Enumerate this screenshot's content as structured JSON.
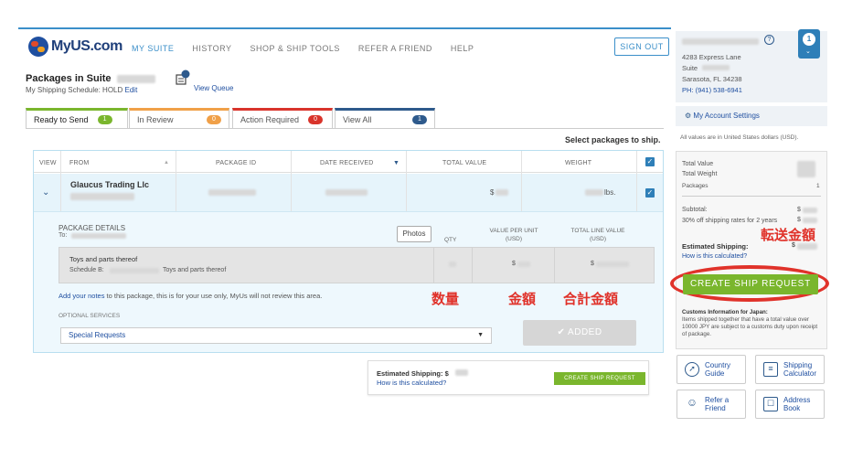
{
  "brand": {
    "name": "MyUS.com"
  },
  "nav": {
    "items": [
      "MY SUITE",
      "HISTORY",
      "SHOP & SHIP TOOLS",
      "REFER A FRIEND",
      "HELP"
    ],
    "sign_out": "SIGN OUT"
  },
  "suite": {
    "title": "Packages in Suite",
    "schedule_label": "My Shipping Schedule: HOLD",
    "edit": "Edit",
    "queue_count": "0",
    "view_queue": "View Queue"
  },
  "tabs": [
    {
      "label": "Ready to Send",
      "count": "1",
      "color": "#7ab62d"
    },
    {
      "label": "In Review",
      "count": "0",
      "color": "#f0a048"
    },
    {
      "label": "Action Required",
      "count": "0",
      "color": "#d9342b"
    },
    {
      "label": "View All",
      "count": "1",
      "color": "#2e5a8c"
    }
  ],
  "select_hint": "Select packages to ship.",
  "table": {
    "headers": {
      "view": "VIEW",
      "from": "FROM",
      "package_id": "PACKAGE ID",
      "date": "DATE RECEIVED",
      "total_value": "TOTAL VALUE",
      "weight": "WEIGHT"
    },
    "row": {
      "from": "Glaucus Trading Llc",
      "value_prefix": "$",
      "weight_suffix": "lbs."
    }
  },
  "details": {
    "title": "PACKAGE DETAILS",
    "to_label": "To:",
    "photos": "Photos",
    "qty": "QTY",
    "value_per_unit": "VALUE PER UNIT",
    "value_per_unit_unit": "(USD)",
    "total_line_value": "TOTAL LINE VALUE",
    "total_line_value_unit": "(USD)",
    "item_name": "Toys and parts thereof",
    "schedule_b_label": "Schedule B:",
    "schedule_b_desc": "Toys and parts thereof",
    "dollar": "$",
    "notes_link": "Add your notes",
    "notes_text": "to this package, this is for your use only, MyUs will not review this area.",
    "optional_services": "OPTIONAL SERVICES",
    "special_requests": "Special Requests",
    "added": "ADDED"
  },
  "annotations": {
    "qty": "数量",
    "amount": "金額",
    "total": "合計金額",
    "shipping": "転送金額"
  },
  "bottom_bar": {
    "estimated": "Estimated Shipping: $",
    "how": "How is this calculated?",
    "button": "CREATE SHIP REQUEST"
  },
  "account": {
    "street": "4283 Express Lane",
    "suite": "Suite",
    "city": "Sarasota, FL 34238",
    "phone": "PH: (941) 538-6941",
    "notif_count": "1",
    "settings": "My Account Settings"
  },
  "summary": {
    "usd_note": "All values are in United States dollars (USD).",
    "total_value": "Total Value",
    "total_weight": "Total Weight",
    "packages": "Packages",
    "packages_count": "1",
    "subtotal": "Subtotal:",
    "dollar": "$",
    "discount": "30% off shipping rates for 2 years",
    "estimated": "Estimated Shipping:",
    "how": "How is this calculated?",
    "button": "CREATE SHIP REQUEST",
    "customs_title": "Customs Information for Japan:",
    "customs_text": "Items shipped together that have a total value over 10000 JPY are subject to a customs duty upon receipt of package."
  },
  "tools": [
    {
      "line1": "Country",
      "line2": "Guide",
      "icon": "compass-icon"
    },
    {
      "line1": "Shipping",
      "line2": "Calculator",
      "icon": "calculator-icon"
    },
    {
      "line1": "Refer a",
      "line2": "Friend",
      "icon": "people-icon"
    },
    {
      "line1": "Address",
      "line2": "Book",
      "icon": "address-book-icon"
    }
  ]
}
